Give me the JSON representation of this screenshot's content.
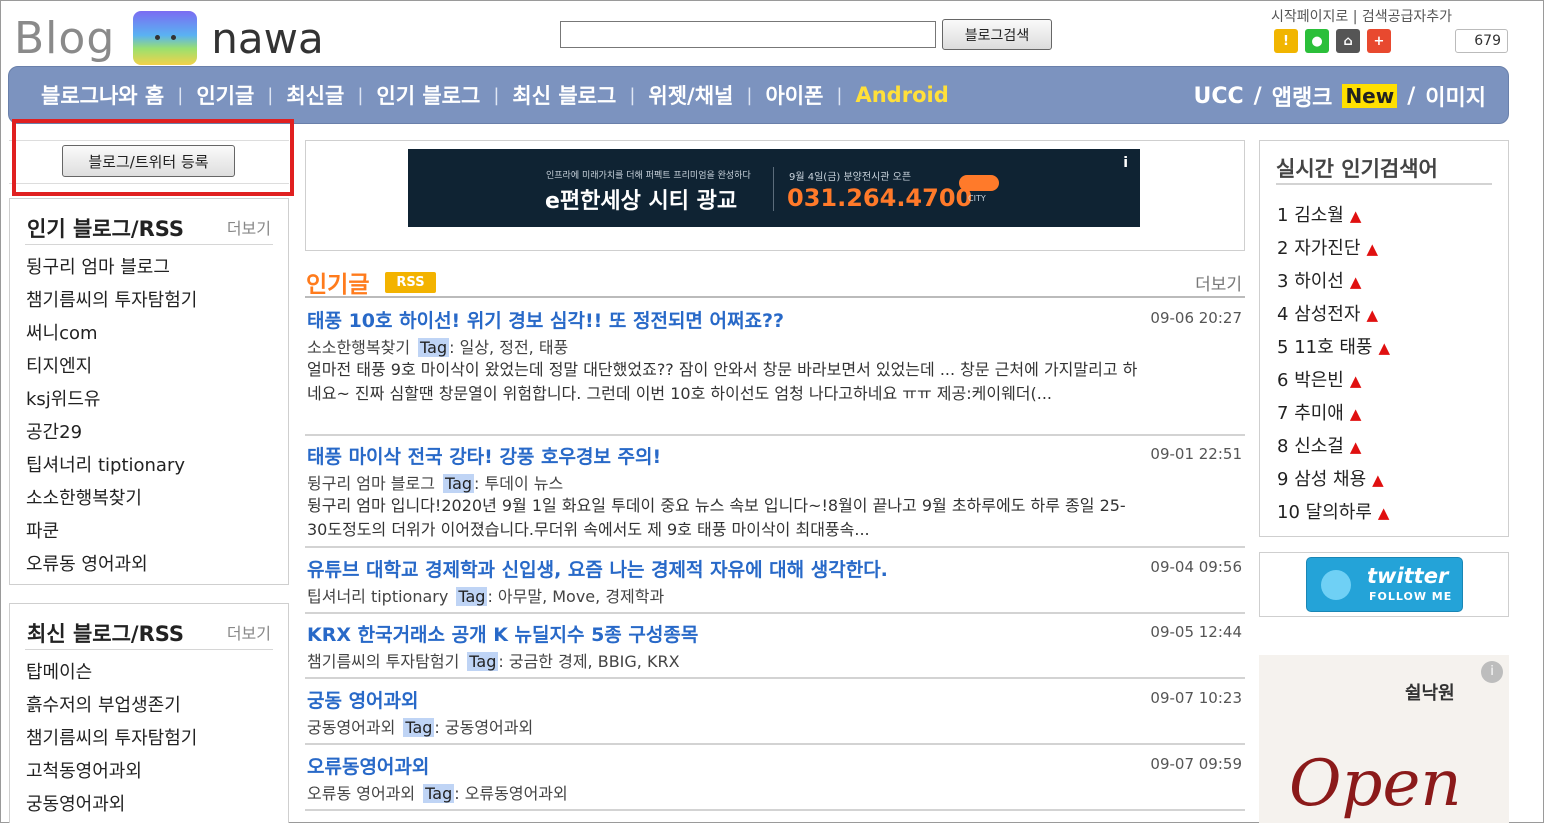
{
  "header": {
    "logo_blog": "Blog",
    "logo_nawa": "nawa",
    "search_button": "블로그검색",
    "search_placeholder": "",
    "top_links": "시작페이지로 | 검색공급자추가",
    "share_count": "679"
  },
  "nav": {
    "items": [
      "블로그나와 홈",
      "인기글",
      "최신글",
      "인기 블로그",
      "최신 블로그",
      "위젯/채널",
      "아이폰",
      "Android"
    ],
    "right": [
      "UCC",
      "앱랭크",
      "New",
      "이미지"
    ]
  },
  "left": {
    "register_button": "블로그/트위터 등록",
    "popular": {
      "title": "인기 블로그/RSS",
      "more": "더보기",
      "items": [
        "뒹구리 엄마 블로그",
        "챔기름씨의 투자탐험기",
        "써니com",
        "티지엔지",
        "ksj위드유",
        "공간29",
        "팁셔너리 tiptionary",
        "소소한행복찾기",
        "파쿤",
        "오류동 영어과외"
      ]
    },
    "recent": {
      "title": "최신 블로그/RSS",
      "more": "더보기",
      "items": [
        "탑메이슨",
        "흙수저의 부업생존기",
        "챔기름씨의 투자탐험기",
        "고척동영어과외",
        "궁동영어과외"
      ]
    }
  },
  "ad": {
    "small1": "인프라에 미래가치를 더해 퍼펙트 프리미엄을 완성하다",
    "big1": "e편한세상 시티 광교",
    "small2": "9월 4일(금) 분양전시관 오픈",
    "phone": "031.264.4700",
    "city": "CITY",
    "info": "i"
  },
  "hot": {
    "title": "인기글",
    "rss": "RSS",
    "more": "더보기",
    "tag_label": "Tag",
    "posts": [
      {
        "title": "태풍 10호 하이선! 위기 경보 심각!! 또 정전되면 어쩌죠??",
        "date": "09-06 20:27",
        "blog": "소소한행복찾기",
        "tags": ": 일상, 정전, 태풍",
        "body": "얼마전 태풍 9호 마이삭이 왔었는데 정말 대단했었죠?? 잠이 안와서 창문 바라보면서 있었는데 ... 창문 근처에 가지말리고 하네요~ 진짜 심할땐 창문열이 위험합니다. 그런데 이번 10호 하이선도 엄청 나다고하네요 ㅠㅠ 제공:케이웨더(..."
      },
      {
        "title": "태풍 마이삭 전국 강타! 강풍 호우경보 주의!",
        "date": "09-01 22:51",
        "blog": "뒹구리 엄마 블로그",
        "tags": ": 투데이 뉴스",
        "body": "뒹구리 엄마 입니다!2020년 9월 1일 화요일 투데이 중요 뉴스 속보 입니다~!8월이 끝나고 9월 초하루에도 하루 종일 25-30도정도의 더위가 이어졌습니다.무더위 속에서도 제 9호 태풍 마이삭이 최대풍속..."
      },
      {
        "title": "유튜브 대학교 경제학과 신입생, 요즘 나는 경제적 자유에 대해 생각한다.",
        "date": "09-04 09:56",
        "blog": "팁셔너리 tiptionary",
        "tags": ": 아무말, Move, 경제학과",
        "body": ""
      },
      {
        "title": "KRX 한국거래소 공개 K 뉴딜지수 5종 구성종목",
        "date": "09-05 12:44",
        "blog": "챔기름씨의 투자탐험기",
        "tags": ": 궁금한 경제, BBIG, KRX",
        "body": ""
      },
      {
        "title": "궁동 영어과외",
        "date": "09-07 10:23",
        "blog": "궁동영어과외",
        "tags": ": 궁동영어과외",
        "body": ""
      },
      {
        "title": "오류동영어과외",
        "date": "09-07 09:59",
        "blog": "오류동 영어과외",
        "tags": ": 오류동영어과외",
        "body": ""
      }
    ]
  },
  "right": {
    "rank_title": "실시간 인기검색어",
    "ranks": [
      {
        "n": "1",
        "term": "김소월"
      },
      {
        "n": "2",
        "term": "자가진단"
      },
      {
        "n": "3",
        "term": "하이선"
      },
      {
        "n": "4",
        "term": "삼성전자"
      },
      {
        "n": "5",
        "term": "11호 태풍"
      },
      {
        "n": "6",
        "term": "박은빈"
      },
      {
        "n": "7",
        "term": "추미애"
      },
      {
        "n": "8",
        "term": "신소걸"
      },
      {
        "n": "9",
        "term": "삼성 채용"
      },
      {
        "n": "10",
        "term": "달의하루"
      }
    ],
    "up_arrow": "▲",
    "twitter_text": "twitter",
    "twitter_follow": "FOLLOW ME",
    "open_brand": "쉴낙원",
    "open_text": "Open",
    "open_info": "i"
  },
  "colors": {
    "nav_bg": "#7c93bf",
    "accent_orange": "#ff7b1c",
    "link_blue": "#2869c8",
    "highlight_box": "#e02020"
  }
}
